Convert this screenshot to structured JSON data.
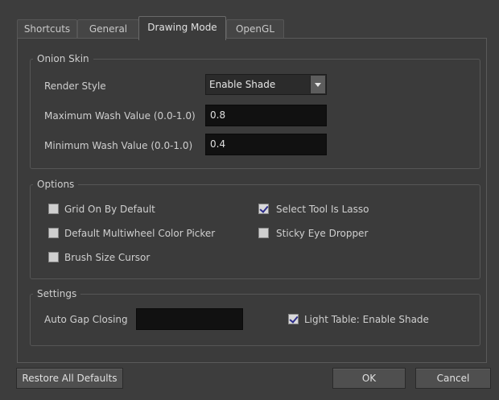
{
  "tabs": [
    {
      "label": "Shortcuts"
    },
    {
      "label": "General"
    },
    {
      "label": "Drawing Mode"
    },
    {
      "label": "OpenGL"
    }
  ],
  "active_tab": "Drawing Mode",
  "onion_skin": {
    "title": "Onion Skin",
    "render_style_label": "Render Style",
    "render_style_value": "Enable Shade",
    "max_wash_label": "Maximum Wash Value (0.0-1.0)",
    "max_wash_value": "0.8",
    "min_wash_label": "Minimum Wash Value (0.0-1.0)",
    "min_wash_value": "0.4"
  },
  "options": {
    "title": "Options",
    "grid_on_default": {
      "label": "Grid On By Default",
      "checked": false
    },
    "multiwheel_picker": {
      "label": "Default Multiwheel Color Picker",
      "checked": false
    },
    "brush_size_cursor": {
      "label": "Brush Size Cursor",
      "checked": false
    },
    "select_tool_lasso": {
      "label": "Select Tool Is Lasso",
      "checked": true
    },
    "sticky_eye_dropper": {
      "label": "Sticky Eye Dropper",
      "checked": false
    }
  },
  "settings": {
    "title": "Settings",
    "auto_gap_label": "Auto Gap Closing",
    "auto_gap_value": "",
    "light_table": {
      "label": "Light Table: Enable Shade",
      "checked": true
    }
  },
  "buttons": {
    "restore": "Restore All Defaults",
    "ok": "OK",
    "cancel": "Cancel"
  }
}
